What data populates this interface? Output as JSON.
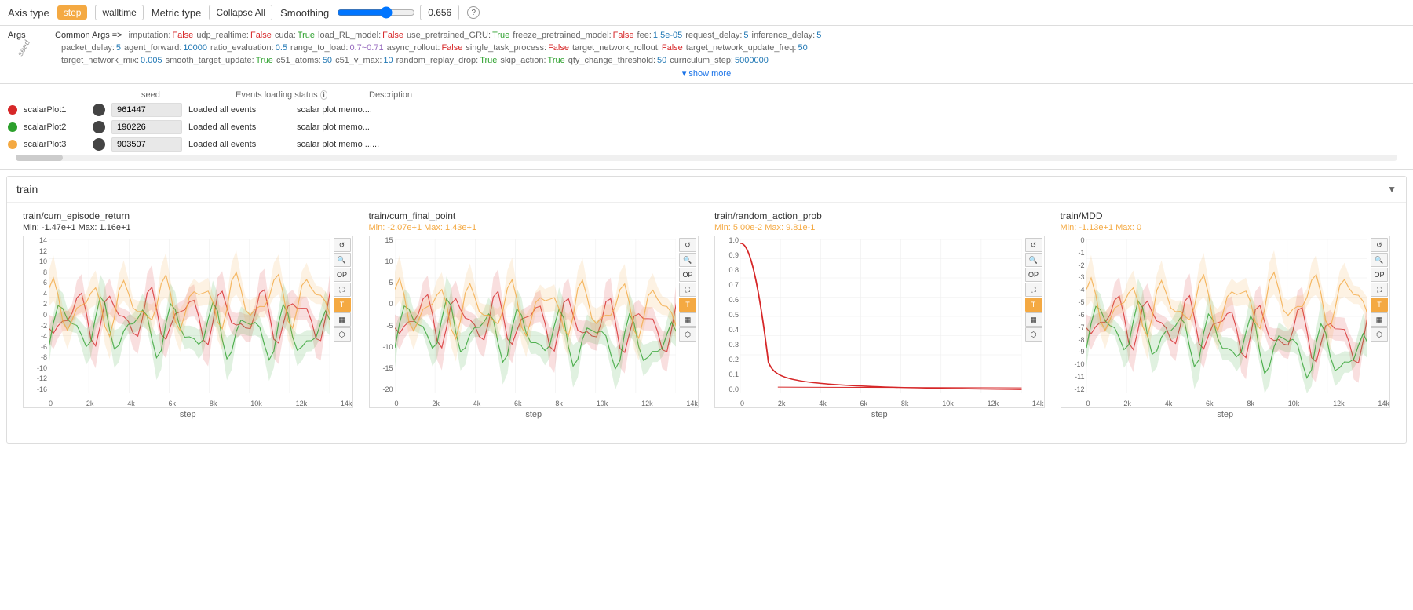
{
  "toolbar": {
    "axis_type_label": "Axis type",
    "step_label": "step",
    "walltime_label": "walltime",
    "metric_type_label": "Metric type",
    "collapse_all_label": "Collapse All",
    "smoothing_label": "Smoothing",
    "smoothing_value": "0.656"
  },
  "args": {
    "args_label": "Args",
    "common_args_label": "Common Args =>",
    "seed_label": "seed",
    "params_row1": [
      {
        "name": "imputation:",
        "value": "False",
        "type": "false"
      },
      {
        "name": "udp_realtime:",
        "value": "False",
        "type": "false"
      },
      {
        "name": "cuda:",
        "value": "True",
        "type": "true"
      },
      {
        "name": "load_RL_model:",
        "value": "False",
        "type": "false"
      },
      {
        "name": "use_pretrained_GRU:",
        "value": "True",
        "type": "true"
      },
      {
        "name": "freeze_pretrained_model:",
        "value": "False",
        "type": "false"
      },
      {
        "name": "fee:",
        "value": "1.5e-05",
        "type": "num"
      },
      {
        "name": "request_delay:",
        "value": "5",
        "type": "num"
      },
      {
        "name": "inference_delay:",
        "value": "5",
        "type": "num"
      }
    ],
    "params_row2": [
      {
        "name": "packet_delay:",
        "value": "5",
        "type": "num"
      },
      {
        "name": "agent_forward:",
        "value": "10000",
        "type": "num"
      },
      {
        "name": "ratio_evaluation:",
        "value": "0.5",
        "type": "num"
      },
      {
        "name": "range_to_load:",
        "value": "0.7~0.71",
        "type": "str"
      },
      {
        "name": "async_rollout:",
        "value": "False",
        "type": "false"
      },
      {
        "name": "single_task_process:",
        "value": "False",
        "type": "false"
      },
      {
        "name": "target_network_rollout:",
        "value": "False",
        "type": "false"
      },
      {
        "name": "target_network_update_freq:",
        "value": "50",
        "type": "num"
      }
    ],
    "params_row3": [
      {
        "name": "target_network_mix:",
        "value": "0.005",
        "type": "num"
      },
      {
        "name": "smooth_target_update:",
        "value": "True",
        "type": "true"
      },
      {
        "name": "c51_atoms:",
        "value": "50",
        "type": "num"
      },
      {
        "name": "c51_v_max:",
        "value": "10",
        "type": "num"
      },
      {
        "name": "random_replay_drop:",
        "value": "True",
        "type": "true"
      },
      {
        "name": "skip_action:",
        "value": "True",
        "type": "true"
      },
      {
        "name": "qty_change_threshold:",
        "value": "50",
        "type": "num"
      },
      {
        "name": "curriculum_step:",
        "value": "5000000",
        "type": "num"
      }
    ],
    "show_more_label": "▾ show more"
  },
  "runs": {
    "col_seed": "seed",
    "col_status": "Events loading status",
    "col_desc": "Description",
    "items": [
      {
        "name": "scalarPlot1",
        "color": "#d62728",
        "seed": "961447",
        "status": "Loaded all events",
        "desc": "scalar plot memo...."
      },
      {
        "name": "scalarPlot2",
        "color": "#2ca02c",
        "seed": "190226",
        "status": "Loaded all events",
        "desc": "scalar plot memo..."
      },
      {
        "name": "scalarPlot3",
        "color": "#f4a942",
        "seed": "903507",
        "status": "Loaded all events",
        "desc": "scalar plot memo ......"
      }
    ]
  },
  "train_section": {
    "title": "train",
    "charts": [
      {
        "title": "train/cum_episode_return",
        "minmax": "Min: -1.47e+1  Max: 1.16e+1",
        "minmax_color": "default",
        "xlabel": "step",
        "y_labels": [
          "14",
          "12",
          "10",
          "8",
          "6",
          "4",
          "2",
          "0",
          "-2",
          "-4",
          "-6",
          "-8",
          "-10",
          "-12",
          "-16"
        ],
        "x_labels": [
          "0",
          "2k",
          "4k",
          "6k",
          "8k",
          "10k",
          "12k",
          "14k"
        ]
      },
      {
        "title": "train/cum_final_point",
        "minmax": "Min: -2.07e+1  Max: 1.43e+1",
        "minmax_color": "orange",
        "xlabel": "step",
        "y_labels": [
          "15",
          "10",
          "5",
          "0",
          "-5",
          "-10",
          "-15",
          "-20"
        ],
        "x_labels": [
          "0",
          "2k",
          "4k",
          "6k",
          "8k",
          "10k",
          "12k",
          "14k"
        ]
      },
      {
        "title": "train/random_action_prob",
        "minmax": "Min: 5.00e-2  Max: 9.81e-1",
        "minmax_color": "orange",
        "xlabel": "step",
        "y_labels": [
          "1.0",
          "0.9",
          "0.8",
          "0.7",
          "0.6",
          "0.5",
          "0.4",
          "0.3",
          "0.2",
          "0.1",
          "0.0"
        ],
        "x_labels": [
          "0",
          "2k",
          "4k",
          "6k",
          "8k",
          "10k",
          "12k",
          "14k"
        ]
      },
      {
        "title": "train/MDD",
        "minmax": "Min: -1.13e+1  Max: 0",
        "minmax_color": "orange",
        "xlabel": "step",
        "y_labels": [
          "0",
          "-1",
          "-2",
          "-3",
          "-4",
          "-5",
          "-6",
          "-7",
          "-8",
          "-9",
          "-10",
          "-11",
          "-12"
        ],
        "x_labels": [
          "0",
          "2k",
          "4k",
          "6k",
          "8k",
          "10k",
          "12k",
          "14k"
        ]
      }
    ],
    "buttons": [
      "↺",
      "🔍",
      "OP",
      "⛶",
      "T",
      "📊",
      "📈"
    ]
  }
}
